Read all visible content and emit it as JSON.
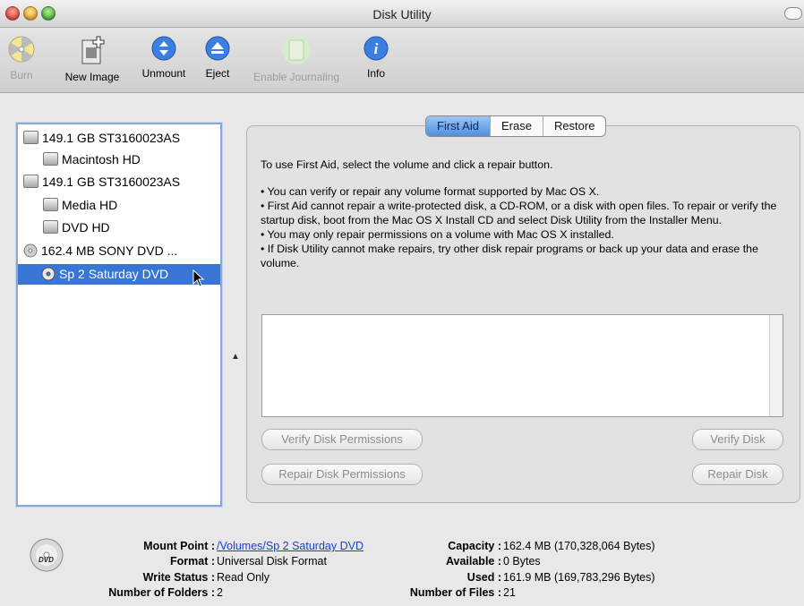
{
  "window": {
    "title": "Disk Utility"
  },
  "toolbar": {
    "items": [
      {
        "label": "Burn",
        "enabled": false
      },
      {
        "label": "New Image",
        "enabled": true
      },
      {
        "label": "Unmount",
        "enabled": true
      },
      {
        "label": "Eject",
        "enabled": true
      },
      {
        "label": "Enable Journaling",
        "enabled": false
      },
      {
        "label": "Info",
        "enabled": true
      }
    ]
  },
  "sidebar": {
    "items": [
      {
        "label": "149.1 GB ST3160023AS"
      },
      {
        "label": "Macintosh HD"
      },
      {
        "label": "149.1 GB ST3160023AS"
      },
      {
        "label": "Media HD"
      },
      {
        "label": "DVD HD"
      },
      {
        "label": "162.4 MB SONY     DVD ..."
      },
      {
        "label": "Sp 2 Saturday DVD"
      }
    ]
  },
  "tabs": [
    "First Aid",
    "Erase",
    "Restore"
  ],
  "firstaid": {
    "intro": "To use First Aid, select the volume and click a repair button.",
    "bullets": [
      "• You can verify or repair any volume format supported by Mac OS X.",
      "• First Aid cannot repair a write-protected disk, a CD-ROM, or a disk with open files. To repair or verify the startup disk, boot from the Mac OS X Install CD and select Disk Utility from the Installer Menu.",
      "• You may only repair permissions on a volume with Mac OS X installed.",
      "• If Disk Utility cannot make repairs, try other disk repair programs or back up your data and erase the volume."
    ],
    "buttons": {
      "verify_permissions": "Verify Disk Permissions",
      "repair_permissions": "Repair Disk Permissions",
      "verify_disk": "Verify Disk",
      "repair_disk": "Repair Disk"
    }
  },
  "footer": {
    "mount_point_label": "Mount Point :",
    "mount_point": "/Volumes/Sp 2 Saturday DVD",
    "format_label": "Format :",
    "format": "Universal Disk Format",
    "write_status_label": "Write Status :",
    "write_status": "Read Only",
    "folders_label": "Number of Folders :",
    "folders": "2",
    "capacity_label": "Capacity :",
    "capacity": "162.4 MB (170,328,064 Bytes)",
    "available_label": "Available :",
    "available": "0 Bytes",
    "used_label": "Used :",
    "used": "161.9 MB (169,783,296 Bytes)",
    "files_label": "Number of Files :",
    "files": "21",
    "disc_icon_text": "DVD"
  },
  "colors": {
    "selection": "#3876d6",
    "close": "#e0463f",
    "minimize": "#f0b23a",
    "zoom": "#55b83c"
  }
}
